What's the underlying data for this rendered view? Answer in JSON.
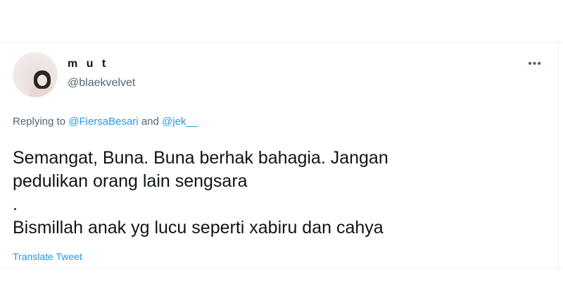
{
  "tweet": {
    "author": {
      "display_name": "m u t",
      "handle": "@blaekvelvet"
    },
    "more_label": "•••",
    "reply_context": {
      "prefix": "Replying to",
      "mention_1": "@FiersaBesari",
      "conjunction": "and",
      "mention_2": "@jek__"
    },
    "text_lines": [
      "Semangat, Buna. Buna berhak bahagia. Jangan",
      "pedulikan orang lain sengsara",
      ".",
      "Bismillah anak yg lucu seperti xabiru dan cahya"
    ],
    "translate_label": "Translate Tweet"
  },
  "colors": {
    "accent": "#1d9bf0",
    "secondary_text": "#536471",
    "primary_text": "#0f1419"
  }
}
